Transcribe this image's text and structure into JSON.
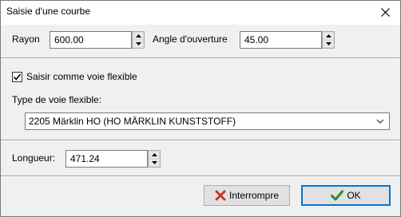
{
  "window": {
    "title": "Saisie d'une courbe"
  },
  "radius": {
    "label": "Rayon",
    "value": "600.00"
  },
  "angle": {
    "label": "Angle d'ouverture",
    "value": "45.00"
  },
  "flex": {
    "checkbox_label": "Saisir comme voie flexible",
    "checked": true,
    "type_label": "Type de voie flexible:",
    "type_value": "2205 Märklin HO (HO MÄRKLIN KUNSTSTOFF)"
  },
  "length": {
    "label": "Longueur:",
    "value": "471.24"
  },
  "buttons": {
    "cancel_label": "Interrompre",
    "ok_label": "OK"
  },
  "colors": {
    "accent": "#0078d7",
    "cancel_icon": "#c0392b",
    "ok_icon": "#2e8b2e"
  }
}
